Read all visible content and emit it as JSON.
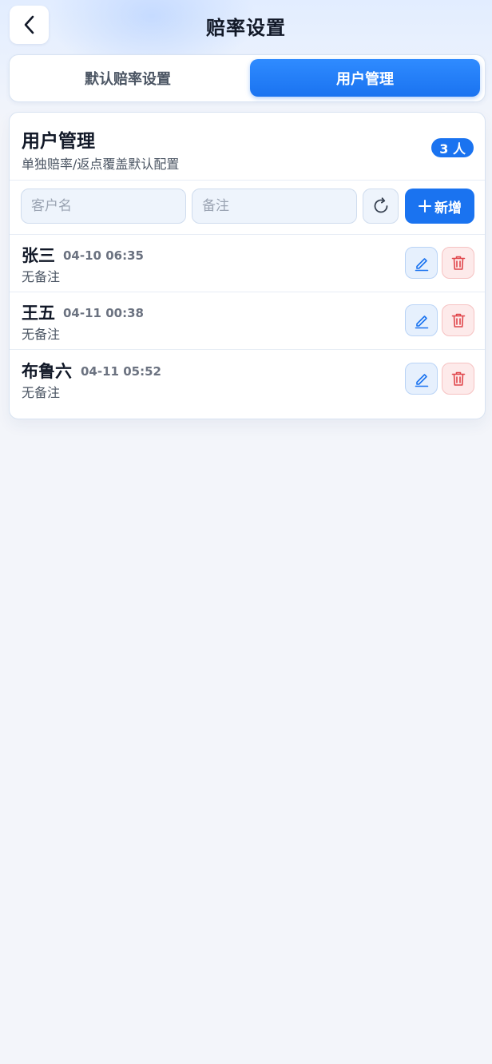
{
  "header": {
    "title": "赔率设置",
    "back_icon": "chevron-left-icon"
  },
  "tabs": [
    {
      "label": "默认赔率设置",
      "active": false
    },
    {
      "label": "用户管理",
      "active": true
    }
  ],
  "card": {
    "title": "用户管理",
    "subtitle": "单独赔率/返点覆盖默认配置",
    "count_badge": "3 人"
  },
  "filters": {
    "customer_name": {
      "placeholder": "客户名",
      "value": ""
    },
    "note": {
      "placeholder": "备注",
      "value": ""
    },
    "refresh_icon": "refresh-icon",
    "add_label": "新增",
    "add_icon": "plus-icon"
  },
  "users": [
    {
      "name": "张三",
      "time": "04-10 06:35",
      "note": "无备注"
    },
    {
      "name": "王五",
      "time": "04-11 00:38",
      "note": "无备注"
    },
    {
      "name": "布鲁六",
      "time": "04-11 05:52",
      "note": "无备注"
    }
  ],
  "colors": {
    "accent": "#1a73f0",
    "edit_icon": "#1a73f0",
    "delete_icon": "#e0454a"
  }
}
